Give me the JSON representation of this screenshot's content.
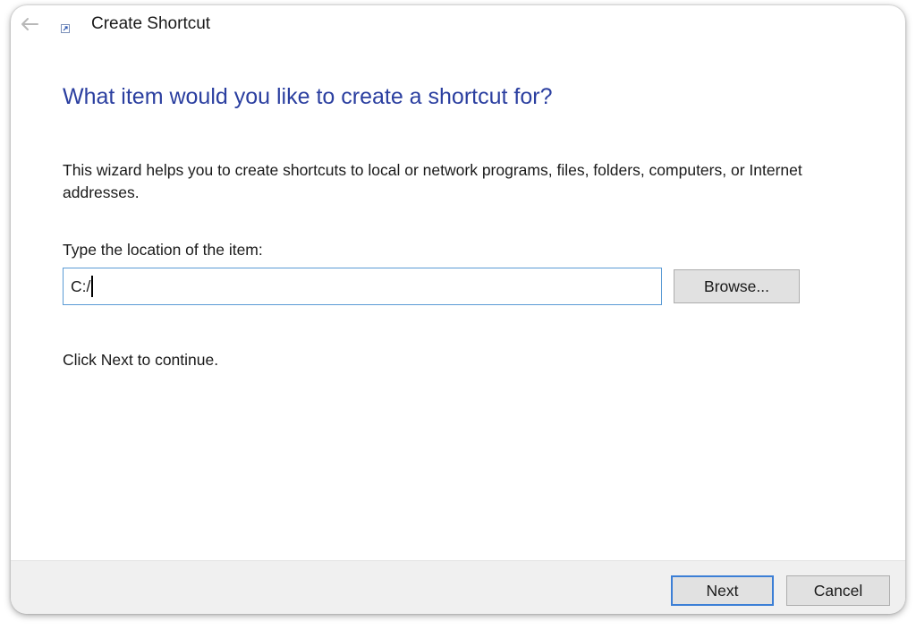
{
  "window": {
    "title": "Create Shortcut"
  },
  "icons": {
    "back": "back-arrow-icon",
    "app": "shortcut-icon"
  },
  "main": {
    "heading": "What item would you like to create a shortcut for?",
    "intro": "This wizard helps you to create shortcuts to local or network programs, files, folders, computers, or Internet addresses.",
    "location_label": "Type the location of the item:",
    "location_value": "C:/",
    "browse_label": "Browse...",
    "continue_text": "Click Next to continue."
  },
  "footer": {
    "next_label": "Next",
    "cancel_label": "Cancel"
  },
  "colors": {
    "heading": "#2b3fa0",
    "input_border": "#5b9bd5",
    "default_button_border": "#3c7fd6",
    "button_face": "#e1e1e1",
    "footer_bg": "#f0f0f0"
  }
}
